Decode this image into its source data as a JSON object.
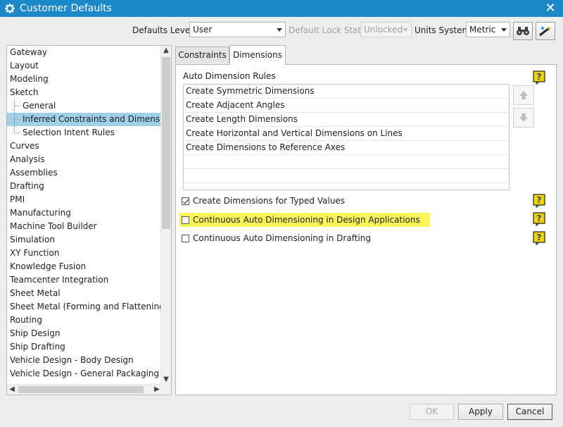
{
  "window": {
    "title": "Customer Defaults",
    "close_glyph": "✕",
    "title_icon": "gear-icon"
  },
  "toolbar": {
    "defaults_level_label": "Defaults Level",
    "defaults_level_value": "User",
    "lock_state_label": "Default Lock State",
    "lock_state_value": "Unlocked",
    "units_label": "Units System",
    "units_value": "Metric",
    "icons": [
      "binoculars-search-icon",
      "settings-wand-icon"
    ]
  },
  "tree": {
    "items": [
      {
        "label": "Gateway",
        "level": 0
      },
      {
        "label": "Layout",
        "level": 0
      },
      {
        "label": "Modeling",
        "level": 0
      },
      {
        "label": "Sketch",
        "level": 0
      },
      {
        "label": "General",
        "level": 1
      },
      {
        "label": "Inferred Constraints and Dimensions",
        "level": 1,
        "selected": true
      },
      {
        "label": "Selection Intent Rules",
        "level": 1
      },
      {
        "label": "Curves",
        "level": 0
      },
      {
        "label": "Analysis",
        "level": 0
      },
      {
        "label": "Assemblies",
        "level": 0
      },
      {
        "label": "Drafting",
        "level": 0
      },
      {
        "label": "PMI",
        "level": 0
      },
      {
        "label": "Manufacturing",
        "level": 0
      },
      {
        "label": "Machine Tool Builder",
        "level": 0
      },
      {
        "label": "Simulation",
        "level": 0
      },
      {
        "label": "XY Function",
        "level": 0
      },
      {
        "label": "Knowledge Fusion",
        "level": 0
      },
      {
        "label": "Teamcenter Integration",
        "level": 0
      },
      {
        "label": "Sheet Metal",
        "level": 0
      },
      {
        "label": "Sheet Metal (Forming and Flattening)",
        "level": 0
      },
      {
        "label": "Routing",
        "level": 0
      },
      {
        "label": "Ship Design",
        "level": 0
      },
      {
        "label": "Ship Drafting",
        "level": 0
      },
      {
        "label": "Vehicle Design - Body Design",
        "level": 0
      },
      {
        "label": "Vehicle Design - General Packaging",
        "level": 0
      }
    ]
  },
  "tabs": [
    {
      "label": "Constraints",
      "active": false
    },
    {
      "label": "Dimensions",
      "active": true
    }
  ],
  "dimensions": {
    "rules_label": "Auto Dimension Rules",
    "rules": [
      "Create Symmetric Dimensions",
      "Create Adjacent Angles",
      "Create Length Dimensions",
      "Create Horizontal and Vertical Dimensions on Lines",
      "Create Dimensions to Reference Axes"
    ],
    "checkboxes": [
      {
        "label": "Create Dimensions for Typed Values",
        "checked": true,
        "highlighted": false
      },
      {
        "label": "Continuous Auto Dimensioning in Design Applications",
        "checked": false,
        "highlighted": true
      },
      {
        "label": "Continuous Auto Dimensioning in Drafting",
        "checked": false,
        "highlighted": false
      }
    ]
  },
  "buttons": {
    "ok": "OK",
    "apply": "Apply",
    "cancel": "Cancel"
  },
  "colors": {
    "titlebar": "#1d88c7",
    "selection": "#9fd0e8",
    "highlight": "#fbf55a",
    "help_icon": "#f2d200"
  }
}
